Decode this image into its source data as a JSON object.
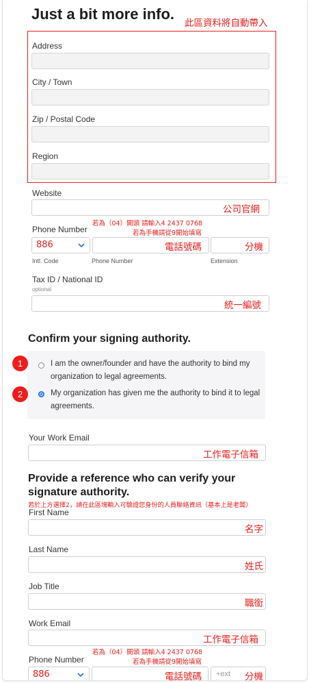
{
  "page": {
    "heading_partial": "Just a bit more info.",
    "auto_fill_note": "此區資料將自動帶入"
  },
  "address_section": {
    "address_label": "Address",
    "city_label": "City / Town",
    "zip_label": "Zip / Postal Code",
    "region_label": "Region"
  },
  "website": {
    "label": "Website",
    "annotation": "公司官網"
  },
  "phone": {
    "label": "Phone Number",
    "note_line1": "若為（04）開頭 請輸入4 2437 0768",
    "note_line2": "若為手機請從9開始填寫",
    "country_code": "886",
    "number_annotation": "電話號碼",
    "extension_annotation": "分機",
    "intl_code_label": "Intl. Code",
    "number_sub_label": "Phone Number",
    "extension_sub_label": "Extension"
  },
  "tax": {
    "label": "Tax ID / National ID",
    "optional": "optional",
    "annotation": "統一編號"
  },
  "authority": {
    "heading": "Confirm your signing authority.",
    "options": [
      {
        "marker": "1",
        "text": "I am the owner/founder and have the authority to bind my organization to legal agreements.",
        "selected": false
      },
      {
        "marker": "2",
        "text": "My organization has given me the authority to bind it to legal agreements.",
        "selected": true
      }
    ]
  },
  "work_email": {
    "label": "Your Work Email",
    "annotation": "工作電子信箱"
  },
  "reference": {
    "heading_line1": "Provide a reference who can verify your",
    "heading_line2": "signature authority.",
    "note": "若於上方選擇2，請在此區塊輸入可驗證您身份的人員聯絡資訊（基本上是老闆）",
    "first_name_label": "First Name",
    "first_name_annotation": "名字",
    "last_name_label": "Last Name",
    "last_name_annotation": "姓氏",
    "job_title_label": "Job Title",
    "job_title_annotation": "職銜",
    "work_email_label": "Work Email",
    "work_email_annotation": "工作電子信箱",
    "phone_label": "Phone Number",
    "phone_note_line1": "若為（04）開頭 請輸入4 2437 0768",
    "phone_note_line2": "若為手機請從9開始填寫",
    "country_code": "886",
    "number_annotation": "電話號碼",
    "ext_placeholder": "+ext",
    "extension_annotation": "分機"
  },
  "colors": {
    "annotation_red": "#e8201c",
    "radio_blue": "#1a73e8"
  }
}
